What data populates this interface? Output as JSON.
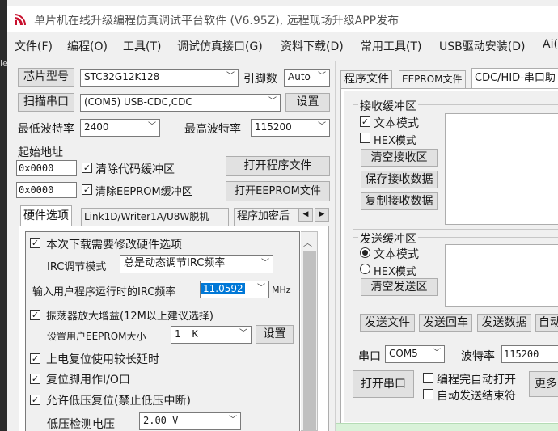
{
  "app": {
    "title": "单片机在线升级编程仿真调试平台软件 (V6.95Z), 远程现场升级APP发布",
    "side_glyph": "le"
  },
  "colors": {
    "accent_selection": "#0078d7",
    "panel_bg": "#f0f0f0",
    "button_bg": "#e1e1e1"
  },
  "menu": [
    "文件(F)",
    "编程(O)",
    "工具(T)",
    "调试仿真接口(G)",
    "资料下载(D)",
    "常用工具(T)",
    "USB驱动安装(D)",
    "Ai("
  ],
  "chip": {
    "label": "芯片型号",
    "value": "STC32G12K128",
    "pin_label": "引脚数",
    "pin_value": "Auto"
  },
  "port": {
    "scan_label": "扫描串口",
    "value": "(COM5) USB-CDC,CDC",
    "settings_label": "设置"
  },
  "baud": {
    "min_label": "最低波特率",
    "min_value": "2400",
    "max_label": "最高波特率",
    "max_value": "115200"
  },
  "address": {
    "label": "起始地址",
    "code_addr": "0x0000",
    "clear_code_label": "清除代码缓冲区",
    "open_program_label": "打开程序文件",
    "eeprom_addr": "0x0000",
    "clear_eeprom_label": "清除EEPROM缓冲区",
    "open_eeprom_label": "打开EEPROM文件"
  },
  "left_tabs": [
    "硬件选项",
    "Link1D/Writer1A/U8W脱机",
    "程序加密后"
  ],
  "hardware": {
    "modify_label": "本次下载需要修改硬件选项",
    "irc_mode_label": "IRC调节模式",
    "irc_mode_value": "总是动态调节IRC频率",
    "irc_freq_label": "输入用户程序运行时的IRC频率",
    "irc_freq_value": "11.0592",
    "irc_freq_unit": "MHz",
    "osc_gain_label": "振荡器放大增益(12M以上建议选择)",
    "eeprom_size_label": "设置用户EEPROM大小",
    "eeprom_size_value": "1  K",
    "eeprom_set_label": "设置",
    "power_reset_label": "上电复位使用较长延时",
    "reset_pin_label": "复位脚用作I/O口",
    "low_volt_label": "允许低压复位(禁止低压中断)",
    "volt_detect_label": "低压检测电压",
    "volt_detect_value": "2.00 V"
  },
  "right_tabs": [
    "程序文件",
    "EEPROM文件",
    "CDC/HID-串口助"
  ],
  "receive": {
    "title": "接收缓冲区",
    "text_mode": "文本模式",
    "hex_mode": "HEX模式",
    "clear_label": "清空接收区",
    "save_label": "保存接收数据",
    "copy_label": "复制接收数据"
  },
  "send": {
    "title": "发送缓冲区",
    "text_mode": "文本模式",
    "hex_mode": "HEX模式",
    "clear_label": "清空发送区",
    "send_file": "发送文件",
    "send_enter": "发送回车",
    "send_data": "发送数据",
    "auto_send": "自动"
  },
  "serial": {
    "port_label": "串口",
    "port_value": "COM5",
    "baud_label": "波特率",
    "baud_value": "115200",
    "open_label": "打开串口",
    "auto_open_label": "编程完自动打开",
    "auto_send_end_label": "自动发送结束符",
    "more_label": "更多"
  }
}
